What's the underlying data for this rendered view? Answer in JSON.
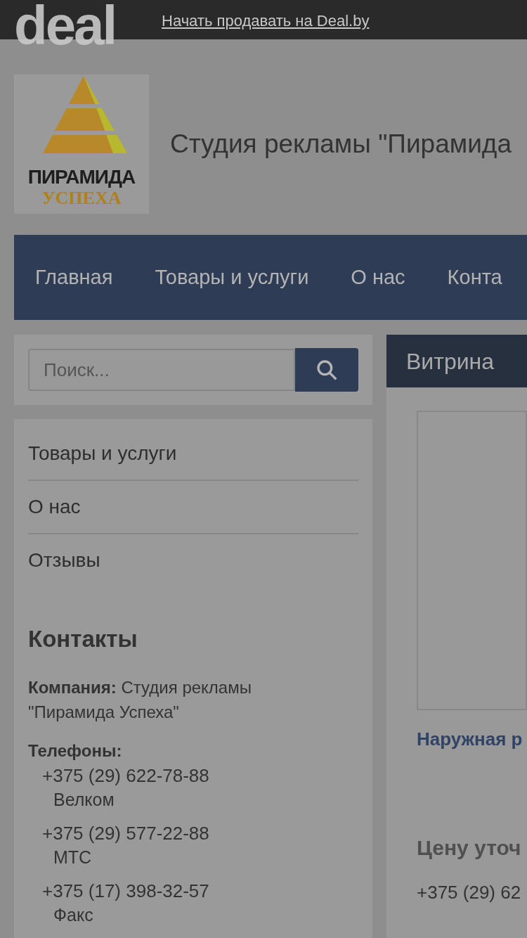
{
  "top_bar": {
    "logo": "deal",
    "link": "Начать продавать на Deal.by"
  },
  "header": {
    "logo": {
      "line_1": "ПИРАМИДА",
      "line_2": "УСПЕХА"
    },
    "title": "Студия рекламы \"Пирамида"
  },
  "nav": [
    "Главная",
    "Товары и услуги",
    "О нас",
    "Конта"
  ],
  "search": {
    "placeholder": "Поиск..."
  },
  "side_menu": [
    "Товары и услуги",
    "О нас",
    "Отзывы"
  ],
  "contacts": {
    "title": "Контакты",
    "company": "**Компания:** Студия рекламы \"Пирамида Успеха\"",
    "phones_label": "Телефоны:",
    "phones": [
      {
        "number": "+375 (29) 622-78-88",
        "note": "Велком"
      },
      {
        "number": "+375 (29) 577-22-88",
        "note": "МТС"
      },
      {
        "number": "+375 (17) 398-32-57",
        "note": "Факс"
      }
    ]
  },
  "showcase": {
    "title": "Витрина",
    "product": {
      "name": "Наружная р",
      "price": "Цену уточ",
      "phone": "+375 (29) 62"
    }
  }
}
